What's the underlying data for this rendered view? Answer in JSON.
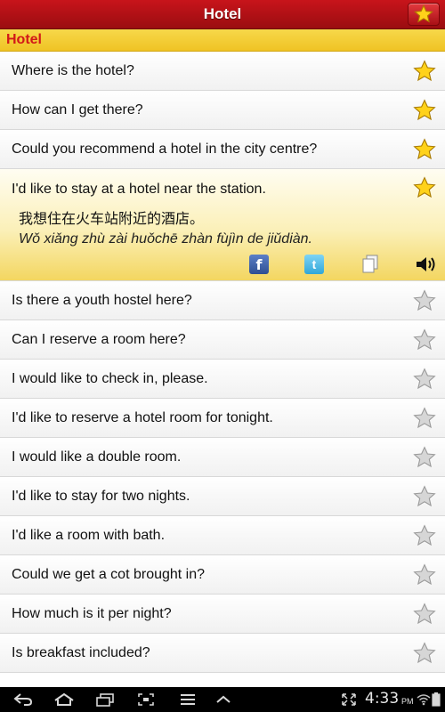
{
  "header": {
    "title": "Hotel"
  },
  "section": {
    "title": "Hotel"
  },
  "phrases": [
    {
      "text": "Where is the hotel?",
      "favorite": true
    },
    {
      "text": "How can I get there?",
      "favorite": true
    },
    {
      "text": "Could you recommend a hotel in the city centre?",
      "favorite": true
    },
    {
      "text": "I'd like to stay at a hotel near the station.",
      "favorite": true,
      "chinese": "我想住在火车站附近的酒店。",
      "pinyin": "Wǒ xiǎng zhù zài huǒchē zhàn fùjìn de jiǔdiàn."
    },
    {
      "text": "Is there a youth hostel here?",
      "favorite": false
    },
    {
      "text": "Can I reserve a room here?",
      "favorite": false
    },
    {
      "text": "I would like to check in, please.",
      "favorite": false
    },
    {
      "text": "I'd like to reserve a hotel room for tonight.",
      "favorite": false
    },
    {
      "text": "I would like a double room.",
      "favorite": false
    },
    {
      "text": "I'd like to stay for two nights.",
      "favorite": false
    },
    {
      "text": "I'd like a room with bath.",
      "favorite": false
    },
    {
      "text": "Could we get a cot brought in?",
      "favorite": false
    },
    {
      "text": "How much is it per night?",
      "favorite": false
    },
    {
      "text": "Is breakfast included?",
      "favorite": false
    }
  ],
  "actions": {
    "facebook_glyph": "f",
    "twitter_glyph": "t"
  },
  "icons": {
    "favorites": "star-icon",
    "facebook": "facebook-icon",
    "twitter": "twitter-icon",
    "copy": "copy-icon",
    "speaker": "speaker-icon"
  },
  "status_bar": {
    "time": "4:33",
    "ampm": "PM"
  },
  "colors": {
    "title_bar": "#b3151a",
    "section_bg": "#f2c92c",
    "section_text": "#d21818",
    "star_active": "#ffd21a",
    "star_inactive": "#cfcfcf",
    "expanded_bg": "#f7e27a"
  }
}
